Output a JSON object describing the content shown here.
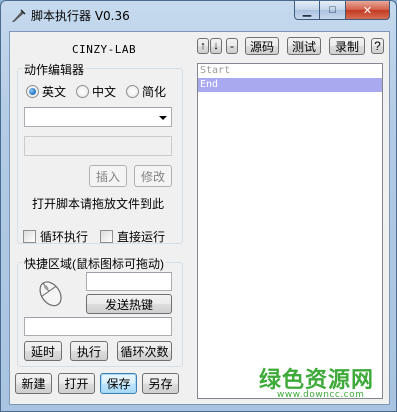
{
  "window": {
    "title": "脚本执行器 V0.36",
    "icon": "script-feather-icon",
    "minimize_glyph": "▁",
    "maximize_glyph": "□",
    "close_glyph": "✕"
  },
  "header": {
    "brand": "CINZY-LAB"
  },
  "toolbar": {
    "up_label": "↑",
    "down_label": "↓",
    "minus_label": "-",
    "source_label": "源码",
    "test_label": "测试",
    "record_label": "录制",
    "help_label": "?"
  },
  "editor": {
    "group_title": "动作编辑器",
    "languages": [
      {
        "label": "英文",
        "selected": true
      },
      {
        "label": "中文",
        "selected": false
      },
      {
        "label": "简化",
        "selected": false
      }
    ],
    "action_combo_value": "",
    "param_field_value": "",
    "insert_label": "插入",
    "modify_label": "修改",
    "drop_hint": "打开脚本请拖放文件到此",
    "loop_label": "循环执行",
    "loop_checked": false,
    "direct_run_label": "直接运行",
    "direct_run_checked": false
  },
  "hotkey": {
    "group_title": "快捷区域(鼠标图标可拖动)",
    "mouse_icon": "mouse-icon",
    "hotkey_field_value": "",
    "send_hotkey_label": "发送热键",
    "text_field_value": "",
    "delay_label": "延时",
    "execute_label": "执行",
    "loop_count_label": "循环次数"
  },
  "script_list": {
    "items": [
      {
        "text": "Start",
        "style": "start"
      },
      {
        "text": "End",
        "style": "end"
      }
    ]
  },
  "bottom": {
    "new_label": "新建",
    "open_label": "打开",
    "save_label": "保存",
    "save_as_label": "另存"
  },
  "watermark": {
    "text": "绿色资源网",
    "url": "www.downcc.com"
  },
  "colors": {
    "accent": "#3c7fb1",
    "selected_row": "#a9a9f0",
    "watermark": "#3eaa3a",
    "close_button": "#c23a22"
  }
}
